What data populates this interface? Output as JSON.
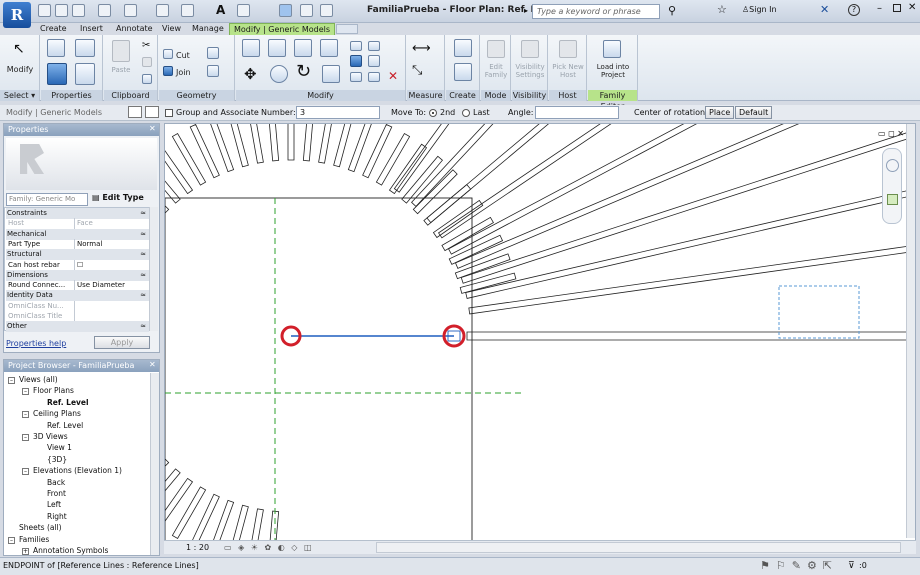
{
  "titlebar": {
    "title": "FamiliaPrueba - Floor Plan: Ref. Le...",
    "search_placeholder": "Type a keyword or phrase",
    "sign_in": "Sign In",
    "help": "?"
  },
  "tabs": [
    "Create",
    "Insert",
    "Annotate",
    "View",
    "Manage",
    "Modify | Generic Models"
  ],
  "ribbon": {
    "modify": "Modify",
    "cut": "Cut",
    "join": "Join",
    "paste": "Paste",
    "edit_family": "Edit Family",
    "visibility_settings": "Visibility Settings",
    "pick_new_host": "Pick New Host",
    "load_into_project": "Load into Project",
    "panels": [
      "Select ▾",
      "Properties",
      "Clipboard",
      "Geometry",
      "Modify",
      "Measure",
      "Create",
      "Mode",
      "Visibility",
      "Host",
      "Family Editor"
    ]
  },
  "options": {
    "context": "Modify | Generic Models",
    "group_associate": "Group and Associate",
    "number_label": "Number:",
    "number_value": "3",
    "move_to": "Move To:",
    "second": "2nd",
    "last": "Last",
    "angle": "Angle:",
    "center": "Center of rotation:",
    "place": "Place",
    "default": "Default"
  },
  "properties": {
    "title": "Properties",
    "family_select": "Family: Generic Mo",
    "edit_type": "Edit Type",
    "help_link": "Properties help",
    "apply": "Apply",
    "rows": [
      {
        "k": "Constraints",
        "v": "",
        "cat": true
      },
      {
        "k": "Host",
        "v": "Face",
        "dis": true
      },
      {
        "k": "Mechanical",
        "v": "",
        "cat": true
      },
      {
        "k": "Part Type",
        "v": "Normal"
      },
      {
        "k": "Structural",
        "v": "",
        "cat": true
      },
      {
        "k": "Can host rebar",
        "v": "☐"
      },
      {
        "k": "Dimensions",
        "v": "",
        "cat": true
      },
      {
        "k": "Round Connec...",
        "v": "Use Diameter"
      },
      {
        "k": "Identity Data",
        "v": "",
        "cat": true
      },
      {
        "k": "OmniClass Nu...",
        "v": "",
        "dis": true
      },
      {
        "k": "OmniClass Title",
        "v": "",
        "dis": true
      },
      {
        "k": "Other",
        "v": "",
        "cat": true
      }
    ]
  },
  "browser": {
    "title": "Project Browser - FamiliaPrueba",
    "items": [
      {
        "t": "Views (all)",
        "lvl": 0,
        "box": "⊟"
      },
      {
        "t": "Floor Plans",
        "lvl": 1,
        "box": "⊟"
      },
      {
        "t": "Ref. Level",
        "lvl": 2,
        "bold": true
      },
      {
        "t": "Ceiling Plans",
        "lvl": 1,
        "box": "⊟"
      },
      {
        "t": "Ref. Level",
        "lvl": 2
      },
      {
        "t": "3D Views",
        "lvl": 1,
        "box": "⊟"
      },
      {
        "t": "View 1",
        "lvl": 2
      },
      {
        "t": "{3D}",
        "lvl": 2
      },
      {
        "t": "Elevations (Elevation 1)",
        "lvl": 1,
        "box": "⊟"
      },
      {
        "t": "Back",
        "lvl": 2
      },
      {
        "t": "Front",
        "lvl": 2
      },
      {
        "t": "Left",
        "lvl": 2
      },
      {
        "t": "Right",
        "lvl": 2
      },
      {
        "t": "Sheets (all)",
        "lvl": 0
      },
      {
        "t": "Families",
        "lvl": 0,
        "box": "⊟"
      },
      {
        "t": "Annotation Symbols",
        "lvl": 1,
        "box": "⊞"
      }
    ]
  },
  "view": {
    "scale": "1 : 20"
  },
  "status": {
    "text": "ENDPOINT of [Reference Lines : Reference Lines]",
    "filter": ":0"
  },
  "colors": {
    "accent": "#b7e38a",
    "selection": "#d21f2a",
    "refline": "#2ca02c",
    "blue": "#1f5fbf"
  }
}
